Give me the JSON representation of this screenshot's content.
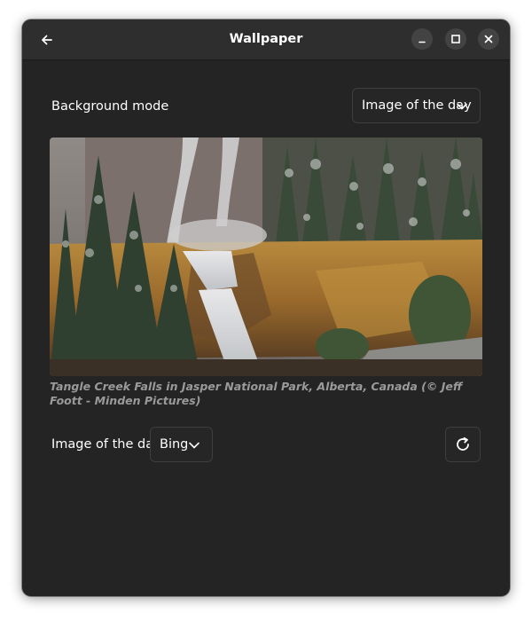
{
  "window": {
    "title": "Wallpaper"
  },
  "header": {
    "back_icon": "arrow-left-icon",
    "minimize_icon": "minimize-icon",
    "maximize_icon": "maximize-icon",
    "close_icon": "close-icon"
  },
  "background_mode": {
    "label": "Background mode",
    "selected": "Image of the day"
  },
  "wallpaper": {
    "caption": "Tangle Creek Falls in Jasper National Park, Alberta, Canada (© Jeff Foott - Minden Pictures)"
  },
  "image_of_day": {
    "label": "Image of the day",
    "source_selected": "Bing",
    "refresh_icon": "refresh-icon"
  },
  "colors": {
    "window_bg": "#242424",
    "header_bg": "#2e2e2e",
    "button_bg": "#434343",
    "caption": "#9a9a9a"
  }
}
